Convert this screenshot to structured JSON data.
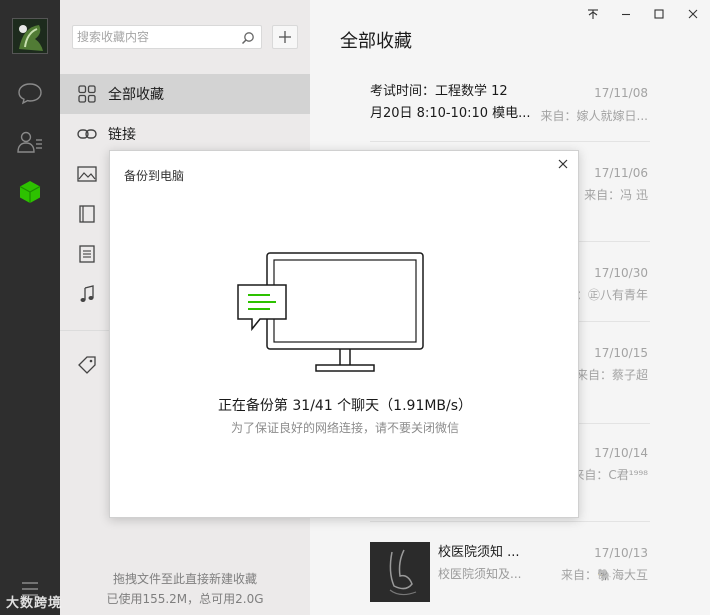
{
  "app": {
    "title": "全部收藏",
    "watermark": "大数跨境",
    "window_buttons": [
      "pin",
      "minimize",
      "maximize",
      "close"
    ]
  },
  "rail": {
    "items": [
      {
        "icon": "chat-icon"
      },
      {
        "icon": "contacts-icon"
      },
      {
        "icon": "favorites-cube-icon",
        "active": true
      }
    ],
    "accent_color": "#2dc100"
  },
  "search": {
    "placeholder": "搜索收藏内容",
    "value": ""
  },
  "categories": [
    {
      "label": "全部收藏",
      "icon": "grid-icon",
      "active": true
    },
    {
      "label": "链接",
      "icon": "link-icon",
      "active": false
    }
  ],
  "category_icons_hidden": [
    "image-icon",
    "notebook-icon",
    "file-icon",
    "music-icon",
    "tag-icon"
  ],
  "footer": {
    "drag_hint": "拖拽文件至此直接新建收藏",
    "usage": "已使用155.2M，总可用2.0G"
  },
  "favorites": [
    {
      "title_line1": "考试时间：工程数学 12",
      "title_line2": "月20日 8:10-10:10 模电...",
      "date": "17/11/08",
      "source": "来自：嫁人就嫁日..."
    },
    {
      "date": "17/11/06",
      "source": "来自：冯  迅"
    },
    {
      "date": "17/10/30",
      "source": "：㊣八有青年"
    },
    {
      "date": "17/10/15",
      "source": "来自：蔡子超"
    },
    {
      "date": "17/10/14",
      "source": "来自：C君¹⁹⁹⁸"
    },
    {
      "title_line1": "校医院须知 ...",
      "title_line2": "校医院须知及...",
      "date": "17/10/13",
      "source": "来自：🐘海大互"
    }
  ],
  "dialog": {
    "title": "备份到电脑",
    "status": "正在备份第 31/41 个聊天（1.91MB/s）",
    "hint": "为了保证良好的网络连接，请不要关闭微信",
    "accent_color": "#2dc100"
  }
}
